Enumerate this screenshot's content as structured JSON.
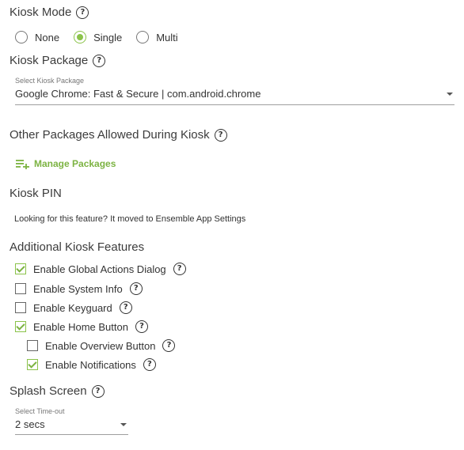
{
  "kiosk_mode": {
    "title": "Kiosk Mode",
    "options": [
      {
        "label": "None",
        "selected": false
      },
      {
        "label": "Single",
        "selected": true
      },
      {
        "label": "Multi",
        "selected": false
      }
    ]
  },
  "kiosk_package": {
    "title": "Kiosk Package",
    "field_label": "Select Kiosk Package",
    "value": "Google Chrome: Fast & Secure | com.android.chrome"
  },
  "other_packages": {
    "title": "Other Packages Allowed During Kiosk",
    "manage_label": "Manage Packages"
  },
  "kiosk_pin": {
    "title": "Kiosk PIN",
    "note": "Looking for this feature? It moved to Ensemble App Settings"
  },
  "additional": {
    "title": "Additional Kiosk Features",
    "items": [
      {
        "label": "Enable Global Actions Dialog",
        "checked": true
      },
      {
        "label": "Enable System Info",
        "checked": false
      },
      {
        "label": "Enable Keyguard",
        "checked": false
      },
      {
        "label": "Enable Home Button",
        "checked": true
      },
      {
        "label": "Enable Overview Button",
        "checked": false
      },
      {
        "label": "Enable Notifications",
        "checked": true
      }
    ]
  },
  "splash": {
    "title": "Splash Screen",
    "field_label": "Select Time-out",
    "value": "2 secs"
  },
  "help_glyph": "?",
  "colors": {
    "accent": "#8bc34a",
    "accent_text": "#7cb342"
  },
  "icons": {
    "help": "help-circle-icon",
    "manage": "playlist-add-icon",
    "dropdown": "chevron-down-icon"
  }
}
